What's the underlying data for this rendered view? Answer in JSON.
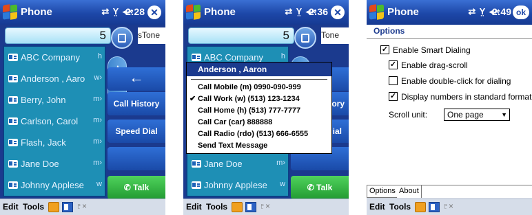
{
  "screens": {
    "dialer": {
      "title": "Phone",
      "status_icons": "⇄ Y̤ ◂×",
      "time": "2:28",
      "number": "5",
      "ringtone_label": "sTone",
      "contacts": [
        {
          "name": "ABC Company",
          "type": "h"
        },
        {
          "name": "Anderson , Aaro",
          "type": "w›"
        },
        {
          "name": "Berry, John",
          "type": "m›"
        },
        {
          "name": "Carlson, Carol",
          "type": "m›"
        },
        {
          "name": "Flash, Jack",
          "type": "m›"
        },
        {
          "name": "Jane Doe",
          "type": "m›"
        },
        {
          "name": "Johnny Applese",
          "type": "w"
        }
      ],
      "buttons": {
        "backspace": "←",
        "call_history": "Call History",
        "speed_dial": "Speed Dial",
        "talk": "✆ Talk"
      }
    },
    "popup_screen": {
      "title": "Phone",
      "status_icons": "⇄ Y̤ ◂×",
      "time": "2:36",
      "number": "5",
      "ringtone_label": "Tone",
      "contacts_visible": [
        {
          "name": "ABC Company",
          "type": "h"
        },
        {
          "name": "Jane Doe",
          "type": "m›"
        },
        {
          "name": "Johnny Applese",
          "type": "w"
        }
      ],
      "buttons": {
        "history_partial": "tory",
        "speed_partial": "ial",
        "talk": "✆ Talk"
      },
      "popup": {
        "header": "Anderson , Aaron",
        "items": [
          {
            "label": "Call Mobile (m) 0990-090-999",
            "checked": false
          },
          {
            "label": "Call Work (w) (513) 123-1234",
            "checked": true
          },
          {
            "label": "Call Home (h) (513) 777-7777",
            "checked": false
          },
          {
            "label": "Call Car (car) 888888",
            "checked": false
          },
          {
            "label": "Call Radio (rdo) (513) 666-6555",
            "checked": false
          },
          {
            "label": "Send Text Message",
            "checked": false
          }
        ],
        "check_mark": "✔"
      }
    },
    "options": {
      "title": "Phone",
      "status_icons": "⇄ Y̤ ◂×",
      "time": "2:49",
      "ok_label": "ok",
      "page_title": "Options",
      "settings": {
        "smart_dialing": {
          "label": "Enable Smart Dialing",
          "checked": true
        },
        "drag_scroll": {
          "label": "Enable drag-scroll",
          "checked": true
        },
        "double_click": {
          "label": "Enable double-click for dialing",
          "checked": false
        },
        "standard_format": {
          "label": "Display numbers in standard format",
          "checked": true
        }
      },
      "check_glyph": "✓",
      "scroll_unit_label": "Scroll unit:",
      "scroll_unit_value": "One page",
      "tabs": [
        "Options",
        "About"
      ]
    }
  },
  "menubar": {
    "edit": "Edit",
    "tools": "Tools",
    "sip_icon": "♇×"
  },
  "colors": {
    "titlebar": "#1d47a8",
    "dialer_bg": "#1b3a8e",
    "contact_list": "#1e8fb5",
    "talk_button": "#229a32"
  }
}
